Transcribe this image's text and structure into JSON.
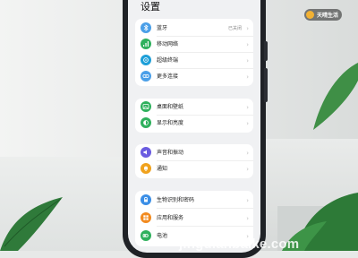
{
  "settings": {
    "title": "设置",
    "groups": [
      {
        "items": [
          {
            "label": "蓝牙",
            "value": "已关闭",
            "icon": "bluetooth-icon",
            "color": "#4a9fe8"
          },
          {
            "label": "移动网络",
            "value": "",
            "icon": "mobile-network-icon",
            "color": "#2fb05d"
          },
          {
            "label": "超级终端",
            "value": "",
            "icon": "super-device-icon",
            "color": "#1e9fd8"
          },
          {
            "label": "更多连接",
            "value": "",
            "icon": "more-connections-icon",
            "color": "#4a9fe8"
          }
        ]
      },
      {
        "items": [
          {
            "label": "桌面和壁纸",
            "value": "",
            "icon": "wallpaper-icon",
            "color": "#2fb05d"
          },
          {
            "label": "显示和亮度",
            "value": "",
            "icon": "display-brightness-icon",
            "color": "#2fb05d"
          }
        ]
      },
      {
        "items": [
          {
            "label": "声音和振动",
            "value": "",
            "icon": "sound-icon",
            "color": "#6a5ce0"
          },
          {
            "label": "通知",
            "value": "",
            "icon": "notification-icon",
            "color": "#f0a21d"
          }
        ]
      },
      {
        "items": [
          {
            "label": "生物识别和密码",
            "value": "",
            "icon": "biometrics-icon",
            "color": "#3a8ee6"
          },
          {
            "label": "应用和服务",
            "value": "",
            "icon": "apps-services-icon",
            "color": "#f28a1f"
          },
          {
            "label": "电池",
            "value": "",
            "icon": "battery-icon",
            "color": "#2fb05d"
          }
        ]
      }
    ]
  },
  "watermark": {
    "top_text": "天晴生活",
    "bottom_text": "jingdianbaike.com"
  }
}
